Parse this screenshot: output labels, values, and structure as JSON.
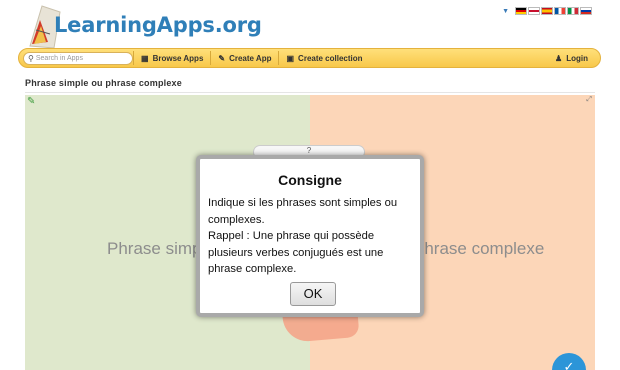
{
  "header": {
    "logo_text": "LearningApps.org",
    "language_flags": [
      "flag-de-icon",
      "flag-uk-icon",
      "flag-es-icon",
      "flag-fr-icon",
      "flag-it-icon",
      "flag-ru-icon"
    ]
  },
  "nav": {
    "search_placeholder": "Search in Apps",
    "browse_apps": "Browse Apps",
    "create_app": "Create App",
    "create_collection": "Create collection",
    "login": "Login"
  },
  "page": {
    "title": "Phrase simple ou phrase complexe"
  },
  "app": {
    "category_left": "Phrase simple",
    "category_right": "Phrase complexe",
    "question_mark": "?",
    "colors": {
      "left": "#dfe8cc",
      "right": "#fcd6b8",
      "accent": "#2c95d8"
    }
  },
  "dialog": {
    "title": "Consigne",
    "line1": "Indique si les phrases sont simples ou complexes.",
    "line2": "Rappel : Une phrase qui possède plusieurs verbes conjugués est une phrase complexe.",
    "ok_label": "OK"
  }
}
